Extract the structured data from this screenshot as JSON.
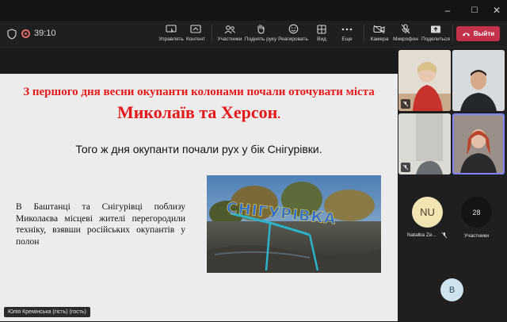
{
  "window": {
    "controls": [
      "–",
      "☐",
      "✕"
    ]
  },
  "toolbar": {
    "timer": "39:10",
    "buttons": {
      "control": "Управлять",
      "content": "Контент",
      "participants": "Участники",
      "raise_hand": "Поднять руку",
      "react": "Реагировать",
      "view": "Вид",
      "more": "Еще",
      "camera": "Камера",
      "mic": "Микрофон",
      "share": "Поделиться"
    },
    "leave_label": "Выйти"
  },
  "slide": {
    "heading_line1": "З першого дня весни окупанти колонами почали оточувати міста",
    "heading_line2": "Миколаїв та Херсон",
    "heading_dot": ".",
    "subheading": "Того ж дня окупанти почали рух у бік Снігурівки.",
    "body": "В Баштанці та Снігурівці поблизу Миколаєва місцеві жителі перегородили техніку, взявши російських окупантів у полон",
    "photo_sign": "СНІГУРІВКА"
  },
  "presenter": {
    "name": "Юлія Кремінська (гість) (гость)"
  },
  "participants": {
    "nu_initials": "NU",
    "nu_name": "Natalka Ze...",
    "count": "28",
    "count_label": "Участники",
    "b_initial": "B"
  },
  "colors": {
    "leave": "#c4314b",
    "slide_heading": "#e5191b",
    "active_speaker": "#7f85f5",
    "nu_avatar": "#f2e4b3",
    "b_avatar": "#cfe3ee"
  }
}
